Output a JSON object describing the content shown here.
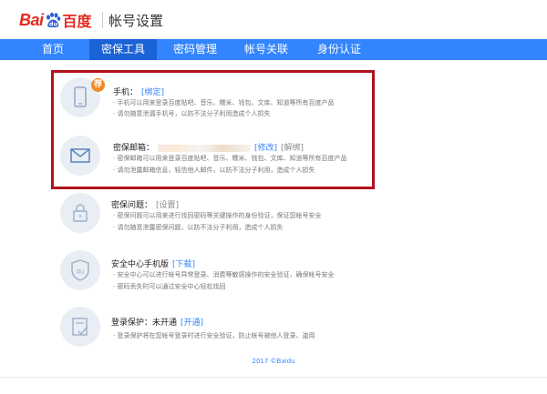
{
  "header": {
    "logo_latin": "Bai",
    "logo_du": "du",
    "logo_cn": "百度",
    "title": "帐号设置"
  },
  "nav": {
    "items": [
      "首页",
      "密保工具",
      "密码管理",
      "帐号关联",
      "身份认证"
    ],
    "active_index": 1
  },
  "sections": {
    "phone": {
      "badge": "荐",
      "title": "手机：",
      "link": "[绑定]",
      "desc1": "· 手机可以用来登录百度贴吧、音乐、糯米、钱包、文库、知道等所有百度产品",
      "desc2": "· 请勿随意泄漏手机号，以防不法分子利用造成个人损失"
    },
    "email": {
      "title": "密保邮箱：",
      "link_modify": "[修改]",
      "link_unbind": "[解绑]",
      "desc1": "· 密保邮箱可以用来登录百度贴吧、音乐、糯米、钱包、文库、知道等所有百度产品",
      "desc2": "· 请勿泄露邮箱信息，轻信他人邮件，以防不法分子利用，造成个人损失"
    },
    "question": {
      "title": "密保问题：",
      "link": "[设置]",
      "desc1": "· 密保问题可以用来进行找回密码等关键操作的身份验证，保证您帐号安全",
      "desc2": "· 请勿随意泄露密保问题，以防不法分子利用，造成个人损失"
    },
    "app": {
      "title": "安全中心手机版",
      "link": "[下载]",
      "desc1": "· 安全中心可以进行帐号异常登录、消费等敏感操作的安全验证，确保帐号安全",
      "desc2": "· 密码丢失时可以通过安全中心轻松找回"
    },
    "login": {
      "title": "登录保护：未开通",
      "link": "[开通]",
      "desc1": "· 登录保护将在您帐号登录时进行安全验证，防止帐号被他人登录、盗用"
    }
  },
  "footer": {
    "copyright": "2017 ©Baidu"
  },
  "colors": {
    "brand_red": "#e52a1f",
    "nav_blue": "#3385ff",
    "nav_active": "#1a63d6",
    "highlight_box": "#b3111b",
    "badge_orange": "#f08a24"
  }
}
